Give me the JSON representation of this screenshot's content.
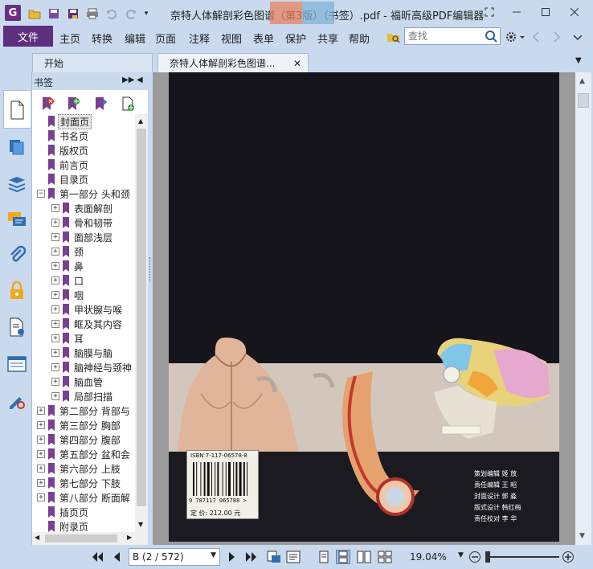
{
  "window": {
    "title": "奈特人体解剖彩色图谱（第3版）（书签）.pdf - 福昕高级PDF编辑器",
    "app_logo": "G"
  },
  "menu": {
    "file": "文件",
    "items": [
      "主页",
      "转换",
      "编辑",
      "页面",
      "注释",
      "视图",
      "表单",
      "保护",
      "共享",
      "帮助"
    ]
  },
  "search": {
    "placeholder": "查找"
  },
  "tabs": [
    {
      "label": "开始"
    },
    {
      "label": "奈特人体解剖彩色图谱..."
    }
  ],
  "bookmarks": {
    "title": "书签",
    "items": [
      {
        "label": "封面页",
        "level": 0,
        "expandable": false,
        "selected": true
      },
      {
        "label": "书名页",
        "level": 0,
        "expandable": false
      },
      {
        "label": "版权页",
        "level": 0,
        "expandable": false
      },
      {
        "label": "前言页",
        "level": 0,
        "expandable": false
      },
      {
        "label": "目录页",
        "level": 0,
        "expandable": false
      },
      {
        "label": "第一部分 头和颈",
        "level": 0,
        "expandable": true,
        "expanded": true
      },
      {
        "label": "表面解剖",
        "level": 1,
        "expandable": true
      },
      {
        "label": "骨和韧带",
        "level": 1,
        "expandable": true
      },
      {
        "label": "面部浅层",
        "level": 1,
        "expandable": true
      },
      {
        "label": "颈",
        "level": 1,
        "expandable": true
      },
      {
        "label": "鼻",
        "level": 1,
        "expandable": true
      },
      {
        "label": "口",
        "level": 1,
        "expandable": true
      },
      {
        "label": "咽",
        "level": 1,
        "expandable": true
      },
      {
        "label": "甲状腺与喉",
        "level": 1,
        "expandable": true
      },
      {
        "label": "眶及其内容",
        "level": 1,
        "expandable": true
      },
      {
        "label": "耳",
        "level": 1,
        "expandable": true
      },
      {
        "label": "脑膜与脑",
        "level": 1,
        "expandable": true
      },
      {
        "label": "脑神经与颈神",
        "level": 1,
        "expandable": true
      },
      {
        "label": "脑血管",
        "level": 1,
        "expandable": true
      },
      {
        "label": "局部扫描",
        "level": 1,
        "expandable": true
      },
      {
        "label": "第二部分 背部与",
        "level": 0,
        "expandable": true
      },
      {
        "label": "第三部分 胸部",
        "level": 0,
        "expandable": true
      },
      {
        "label": "第四部分 腹部",
        "level": 0,
        "expandable": true
      },
      {
        "label": "第五部分 盆和会",
        "level": 0,
        "expandable": true
      },
      {
        "label": "第六部分 上肢",
        "level": 0,
        "expandable": true
      },
      {
        "label": "第七部分 下肢",
        "level": 0,
        "expandable": true
      },
      {
        "label": "第八部分 断面解",
        "level": 0,
        "expandable": true
      },
      {
        "label": "插页页",
        "level": 0,
        "expandable": false
      },
      {
        "label": "附录页",
        "level": 0,
        "expandable": false
      }
    ]
  },
  "cover": {
    "credits": [
      {
        "role": "策划编辑",
        "name": "姬 放"
      },
      {
        "role": "责任编辑",
        "name": "王 昭"
      },
      {
        "role": "封面设计",
        "name": "郭 淼"
      },
      {
        "role": "版式设计",
        "name": "韩红梅"
      },
      {
        "role": "责任校对",
        "name": "李 华"
      }
    ],
    "isbn_top": "ISBN 7-117-06578-8",
    "isbn_digits": "9 787117 065788 >",
    "price": "定  价: 212.00 元"
  },
  "status": {
    "page_display": "B (2 / 572)",
    "zoom": "19.04%"
  },
  "colors": {
    "accent": "#5d2f7e",
    "chrome": "#c9daee",
    "bookmark_flag": "#7b3f8f"
  }
}
